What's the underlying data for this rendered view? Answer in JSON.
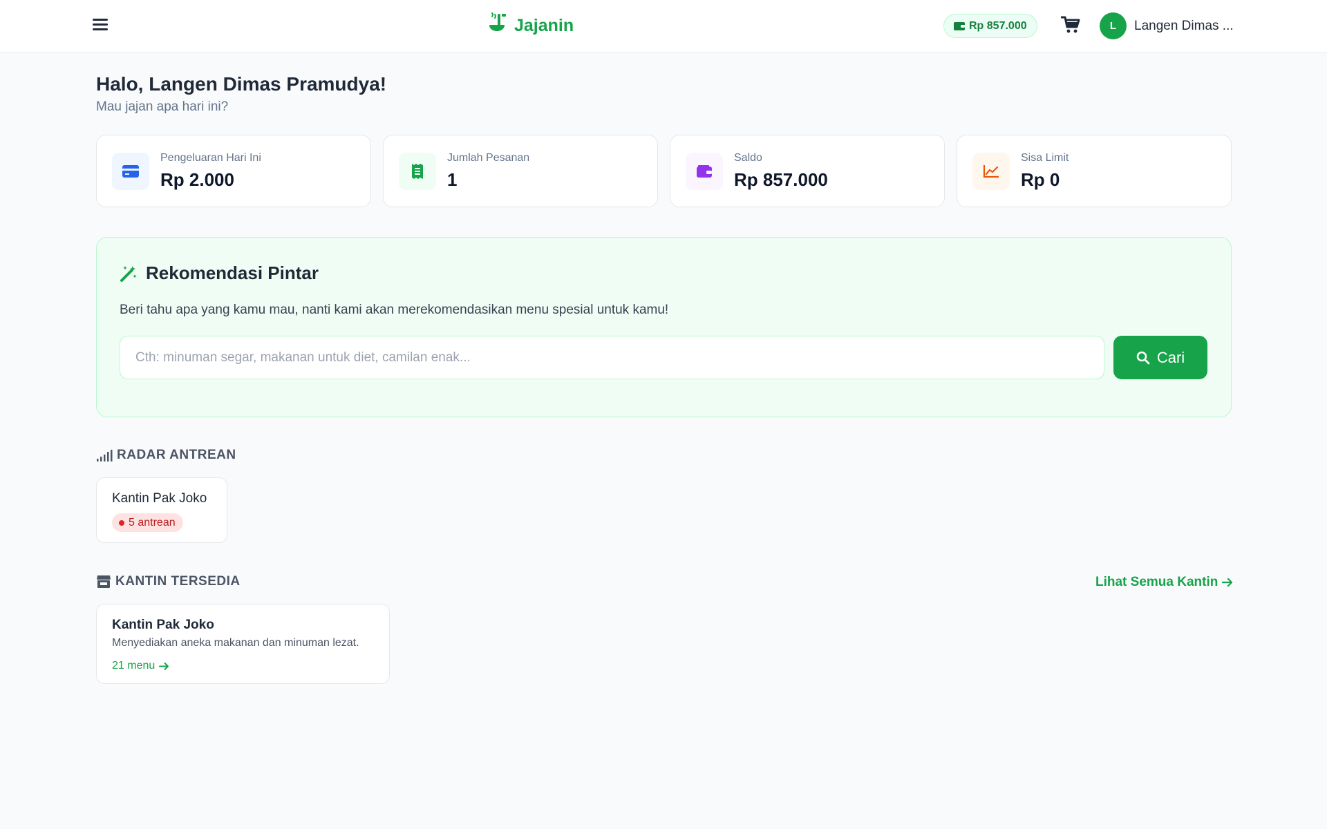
{
  "header": {
    "brand": "Jajanin",
    "balance": "Rp 857.000",
    "user_initial": "L",
    "user_name": "Langen Dimas ..."
  },
  "greeting": {
    "title": "Halo, Langen Dimas Pramudya!",
    "subtitle": "Mau jajan apa hari ini?"
  },
  "stats": [
    {
      "label": "Pengeluaran Hari Ini",
      "value": "Rp 2.000",
      "icon": "credit-card-icon",
      "color": "#2563eb"
    },
    {
      "label": "Jumlah Pesanan",
      "value": "1",
      "icon": "receipt-icon",
      "color": "#16a34a"
    },
    {
      "label": "Saldo",
      "value": "Rp 857.000",
      "icon": "wallet-icon",
      "color": "#9333ea"
    },
    {
      "label": "Sisa Limit",
      "value": "Rp 0",
      "icon": "chart-line-icon",
      "color": "#ea580c"
    }
  ],
  "recommendation": {
    "title": "Rekomendasi Pintar",
    "description": "Beri tahu apa yang kamu mau, nanti kami akan merekomendasikan menu spesial untuk kamu!",
    "placeholder": "Cth: minuman segar, makanan untuk diet, camilan enak...",
    "value": "",
    "button_label": "Cari"
  },
  "queue_radar": {
    "heading": "RADAR ANTREAN",
    "items": [
      {
        "name": "Kantin Pak Joko",
        "badge": "5 antrean"
      }
    ]
  },
  "canteens": {
    "heading": "KANTIN TERSEDIA",
    "see_all": "Lihat Semua Kantin",
    "items": [
      {
        "name": "Kantin Pak Joko",
        "description": "Menyediakan aneka makanan dan minuman lezat.",
        "menu_count": "21 menu"
      }
    ]
  },
  "colors": {
    "primary": "#16a34a",
    "background": "#f8fafc",
    "panel": "#effdf4",
    "danger": "#dc2626"
  }
}
